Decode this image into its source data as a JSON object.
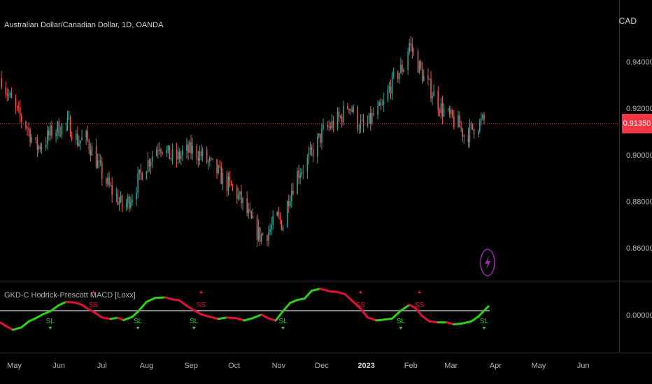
{
  "header": {
    "symbol_title": "Australian Dollar/Canadian Dollar, 1D, OANDA",
    "currency": "CAD"
  },
  "indicator": {
    "title": "GKD-C Hodrick-Prescott MACD [Loxx]",
    "long_label": "SL",
    "short_label": "SS"
  },
  "last_price": {
    "label": "0.91350",
    "value": 0.9135,
    "color": "#f23645"
  },
  "colors": {
    "background": "#000000",
    "bull_candle": "#26a69a",
    "bear_candle": "#ef5350",
    "macd_up": "#31d018",
    "macd_down": "#e0103a",
    "zero_line": "#b2b5be",
    "alert_icon": "#9c27b0"
  },
  "icons": {
    "alert": "lightning-bolt-icon"
  },
  "chart_data": {
    "type": "candlestick",
    "price_axis": {
      "ticks": [
        0.94,
        0.92,
        0.9,
        0.88,
        0.86
      ],
      "tick_labels": [
        "0.94000",
        "0.92000",
        "0.90000",
        "0.88000",
        "0.86000"
      ],
      "ylim": [
        0.8495,
        0.9666
      ]
    },
    "indicator_axis": {
      "ticks": [
        0
      ],
      "tick_labels": [
        "0.00000"
      ]
    },
    "time_axis": {
      "tick_labels": [
        "May",
        "Jun",
        "Jul",
        "Aug",
        "Sep",
        "Oct",
        "Nov",
        "Dec",
        "2023",
        "Feb",
        "Mar",
        "Apr",
        "May",
        "Jun"
      ],
      "tick_dates": [
        "2022-05-01",
        "2022-06-01",
        "2022-07-01",
        "2022-08-01",
        "2022-09-01",
        "2022-10-01",
        "2022-11-01",
        "2022-12-01",
        "2023-01-01",
        "2023-02-01",
        "2023-03-01",
        "2023-04-01",
        "2023-05-01",
        "2023-06-01"
      ],
      "bold": [
        "2023"
      ],
      "xlim": [
        "2022-04-21",
        "2023-06-26"
      ]
    },
    "price_path": [
      [
        "2022-04-22",
        0.933
      ],
      [
        "2022-04-28",
        0.924
      ],
      [
        "2022-05-04",
        0.917
      ],
      [
        "2022-05-10",
        0.912
      ],
      [
        "2022-05-16",
        0.903
      ],
      [
        "2022-05-21",
        0.905
      ],
      [
        "2022-05-27",
        0.91
      ],
      [
        "2022-06-02",
        0.912
      ],
      [
        "2022-06-08",
        0.913
      ],
      [
        "2022-06-14",
        0.906
      ],
      [
        "2022-06-20",
        0.907
      ],
      [
        "2022-06-24",
        0.902
      ],
      [
        "2022-06-30",
        0.893
      ],
      [
        "2022-07-06",
        0.886
      ],
      [
        "2022-07-11",
        0.882
      ],
      [
        "2022-07-16",
        0.877
      ],
      [
        "2022-07-23",
        0.884
      ],
      [
        "2022-07-29",
        0.893
      ],
      [
        "2022-08-04",
        0.899
      ],
      [
        "2022-08-10",
        0.905
      ],
      [
        "2022-08-16",
        0.9
      ],
      [
        "2022-08-21",
        0.898
      ],
      [
        "2022-08-27",
        0.901
      ],
      [
        "2022-09-02",
        0.902
      ],
      [
        "2022-09-08",
        0.9
      ],
      [
        "2022-09-14",
        0.896
      ],
      [
        "2022-09-19",
        0.893
      ],
      [
        "2022-09-25",
        0.888
      ],
      [
        "2022-10-01",
        0.885
      ],
      [
        "2022-10-07",
        0.879
      ],
      [
        "2022-10-13",
        0.871
      ],
      [
        "2022-10-19",
        0.865
      ],
      [
        "2022-10-25",
        0.867
      ],
      [
        "2022-10-31",
        0.873
      ],
      [
        "2022-11-04",
        0.87
      ],
      [
        "2022-11-08",
        0.882
      ],
      [
        "2022-11-14",
        0.892
      ],
      [
        "2022-11-20",
        0.896
      ],
      [
        "2022-11-26",
        0.903
      ],
      [
        "2022-12-02",
        0.91
      ],
      [
        "2022-12-08",
        0.913
      ],
      [
        "2022-12-14",
        0.916
      ],
      [
        "2022-12-20",
        0.922
      ],
      [
        "2022-12-26",
        0.914
      ],
      [
        "2022-12-31",
        0.911
      ],
      [
        "2023-01-06",
        0.917
      ],
      [
        "2023-01-12",
        0.92
      ],
      [
        "2023-01-18",
        0.93
      ],
      [
        "2023-01-23",
        0.935
      ],
      [
        "2023-01-27",
        0.938
      ],
      [
        "2023-01-31",
        0.948
      ],
      [
        "2023-02-04",
        0.942
      ],
      [
        "2023-02-10",
        0.933
      ],
      [
        "2023-02-16",
        0.927
      ],
      [
        "2023-02-22",
        0.92
      ],
      [
        "2023-02-28",
        0.916
      ],
      [
        "2023-03-06",
        0.913
      ],
      [
        "2023-03-11",
        0.908
      ],
      [
        "2023-03-17",
        0.912
      ],
      [
        "2023-03-22",
        0.914
      ],
      [
        "2023-03-25",
        0.915
      ]
    ],
    "hp_macd_path": [
      [
        "2022-04-21",
        -0.6
      ],
      [
        "2022-04-25",
        -0.78
      ],
      [
        "2022-04-30",
        -0.98
      ],
      [
        "2022-05-06",
        -0.85
      ],
      [
        "2022-05-11",
        -0.55
      ],
      [
        "2022-05-16",
        -0.38
      ],
      [
        "2022-05-21",
        -0.18
      ],
      [
        "2022-05-26",
        -0.03
      ],
      [
        "2022-06-01",
        0.28
      ],
      [
        "2022-06-06",
        0.45
      ],
      [
        "2022-06-12",
        0.42
      ],
      [
        "2022-06-17",
        0.3
      ],
      [
        "2022-06-21",
        0.1
      ],
      [
        "2022-06-25",
        -0.05
      ],
      [
        "2022-07-01",
        -0.35
      ],
      [
        "2022-07-07",
        -0.42
      ],
      [
        "2022-07-12",
        -0.36
      ],
      [
        "2022-07-16",
        -0.48
      ],
      [
        "2022-07-22",
        -0.32
      ],
      [
        "2022-07-26",
        -0.05
      ],
      [
        "2022-08-01",
        0.45
      ],
      [
        "2022-08-07",
        0.65
      ],
      [
        "2022-08-14",
        0.68
      ],
      [
        "2022-08-19",
        0.58
      ],
      [
        "2022-08-24",
        0.52
      ],
      [
        "2022-08-29",
        0.25
      ],
      [
        "2022-09-03",
        0.02
      ],
      [
        "2022-09-08",
        -0.18
      ],
      [
        "2022-09-14",
        -0.32
      ],
      [
        "2022-09-20",
        -0.42
      ],
      [
        "2022-09-26",
        -0.35
      ],
      [
        "2022-10-02",
        -0.38
      ],
      [
        "2022-10-08",
        -0.5
      ],
      [
        "2022-10-14",
        -0.38
      ],
      [
        "2022-10-20",
        -0.2
      ],
      [
        "2022-10-25",
        -0.4
      ],
      [
        "2022-10-30",
        -0.5
      ],
      [
        "2022-11-04",
        -0.02
      ],
      [
        "2022-11-09",
        0.4
      ],
      [
        "2022-11-14",
        0.55
      ],
      [
        "2022-11-19",
        0.62
      ],
      [
        "2022-11-24",
        1.02
      ],
      [
        "2022-11-30",
        1.12
      ],
      [
        "2022-12-06",
        1.0
      ],
      [
        "2022-12-12",
        0.95
      ],
      [
        "2022-12-17",
        0.85
      ],
      [
        "2022-12-23",
        0.45
      ],
      [
        "2022-12-28",
        0.1
      ],
      [
        "2023-01-02",
        -0.35
      ],
      [
        "2023-01-08",
        -0.5
      ],
      [
        "2023-01-14",
        -0.45
      ],
      [
        "2023-01-19",
        -0.4
      ],
      [
        "2023-01-25",
        0.0
      ],
      [
        "2023-01-31",
        0.3
      ],
      [
        "2023-02-04",
        0.15
      ],
      [
        "2023-02-09",
        -0.28
      ],
      [
        "2023-02-14",
        -0.55
      ],
      [
        "2023-02-20",
        -0.6
      ],
      [
        "2023-02-26",
        -0.6
      ],
      [
        "2023-03-03",
        -0.7
      ],
      [
        "2023-03-09",
        -0.65
      ],
      [
        "2023-03-15",
        -0.55
      ],
      [
        "2023-03-20",
        -0.3
      ],
      [
        "2023-03-24",
        0.0
      ],
      [
        "2023-03-27",
        0.22
      ]
    ],
    "long_signals": [
      "2022-05-26",
      "2022-07-26",
      "2022-09-03",
      "2022-11-04",
      "2023-01-25",
      "2023-03-24"
    ],
    "short_signals": [
      "2022-06-25",
      "2022-09-08",
      "2022-12-28",
      "2023-02-07"
    ]
  }
}
